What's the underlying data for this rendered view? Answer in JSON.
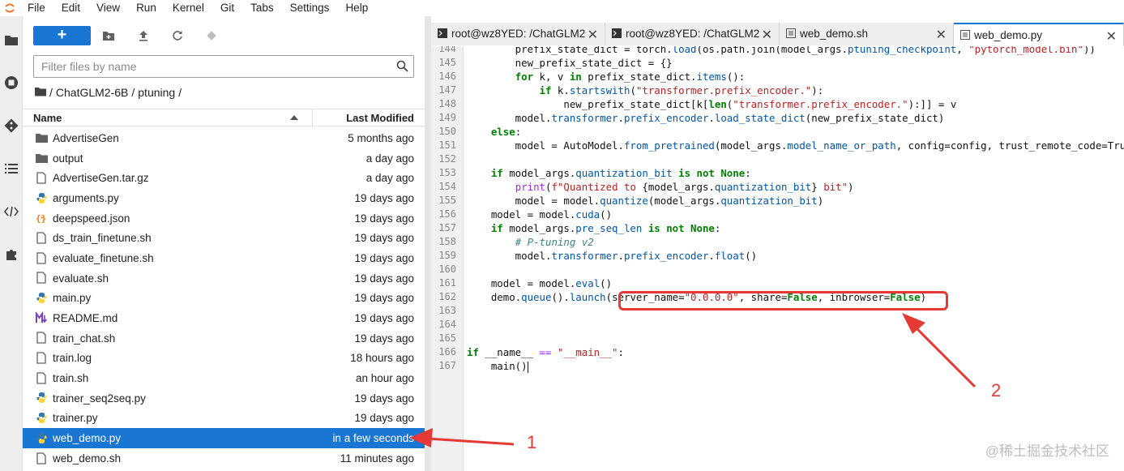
{
  "menubar": {
    "items": [
      "File",
      "Edit",
      "View",
      "Run",
      "Kernel",
      "Git",
      "Tabs",
      "Settings",
      "Help"
    ]
  },
  "activity_icons": [
    "folder-icon",
    "stop-circle-icon",
    "git-icon",
    "list-icon",
    "code-icon",
    "puzzle-icon"
  ],
  "filebrowser": {
    "new_label": "+",
    "search_placeholder": "Filter files by name",
    "breadcrumb": [
      "/",
      "ChatGLM2-6B",
      "/",
      "ptuning",
      "/"
    ],
    "header": {
      "name": "Name",
      "modified": "Last Modified"
    },
    "files": [
      {
        "name": "AdvertiseGen",
        "modified": "5 months ago",
        "type": "folder"
      },
      {
        "name": "output",
        "modified": "a day ago",
        "type": "folder"
      },
      {
        "name": "AdvertiseGen.tar.gz",
        "modified": "a day ago",
        "type": "file"
      },
      {
        "name": "arguments.py",
        "modified": "19 days ago",
        "type": "python"
      },
      {
        "name": "deepspeed.json",
        "modified": "19 days ago",
        "type": "json"
      },
      {
        "name": "ds_train_finetune.sh",
        "modified": "19 days ago",
        "type": "file"
      },
      {
        "name": "evaluate_finetune.sh",
        "modified": "19 days ago",
        "type": "file"
      },
      {
        "name": "evaluate.sh",
        "modified": "19 days ago",
        "type": "file"
      },
      {
        "name": "main.py",
        "modified": "19 days ago",
        "type": "python"
      },
      {
        "name": "README.md",
        "modified": "19 days ago",
        "type": "markdown"
      },
      {
        "name": "train_chat.sh",
        "modified": "19 days ago",
        "type": "file"
      },
      {
        "name": "train.log",
        "modified": "18 hours ago",
        "type": "file"
      },
      {
        "name": "train.sh",
        "modified": "an hour ago",
        "type": "file"
      },
      {
        "name": "trainer_seq2seq.py",
        "modified": "19 days ago",
        "type": "python"
      },
      {
        "name": "trainer.py",
        "modified": "19 days ago",
        "type": "python"
      },
      {
        "name": "web_demo.py",
        "modified": "in a few seconds",
        "type": "python",
        "selected": true
      },
      {
        "name": "web_demo.sh",
        "modified": "11 minutes ago",
        "type": "file"
      }
    ]
  },
  "tabs": [
    {
      "label": "root@wz8YED: /ChatGLM2",
      "icon": "terminal-icon",
      "active": false
    },
    {
      "label": "root@wz8YED: /ChatGLM2",
      "icon": "terminal-icon",
      "active": false
    },
    {
      "label": "web_demo.sh",
      "icon": "file-icon",
      "active": false
    },
    {
      "label": "web_demo.py",
      "icon": "file-icon",
      "active": true
    }
  ],
  "tab_close": "✕",
  "editor": {
    "line_numbers": [
      "144",
      "145",
      "146",
      "147",
      "148",
      "149",
      "150",
      "151",
      "152",
      "153",
      "154",
      "155",
      "156",
      "157",
      "158",
      "159",
      "160",
      "161",
      "162",
      "163",
      "164",
      "165",
      "166",
      "167"
    ]
  },
  "annotations": {
    "one": "1",
    "two": "2"
  },
  "watermark": "@稀土掘金技术社区",
  "colors": {
    "accent": "#1976d2",
    "annotation": "#e53935"
  }
}
